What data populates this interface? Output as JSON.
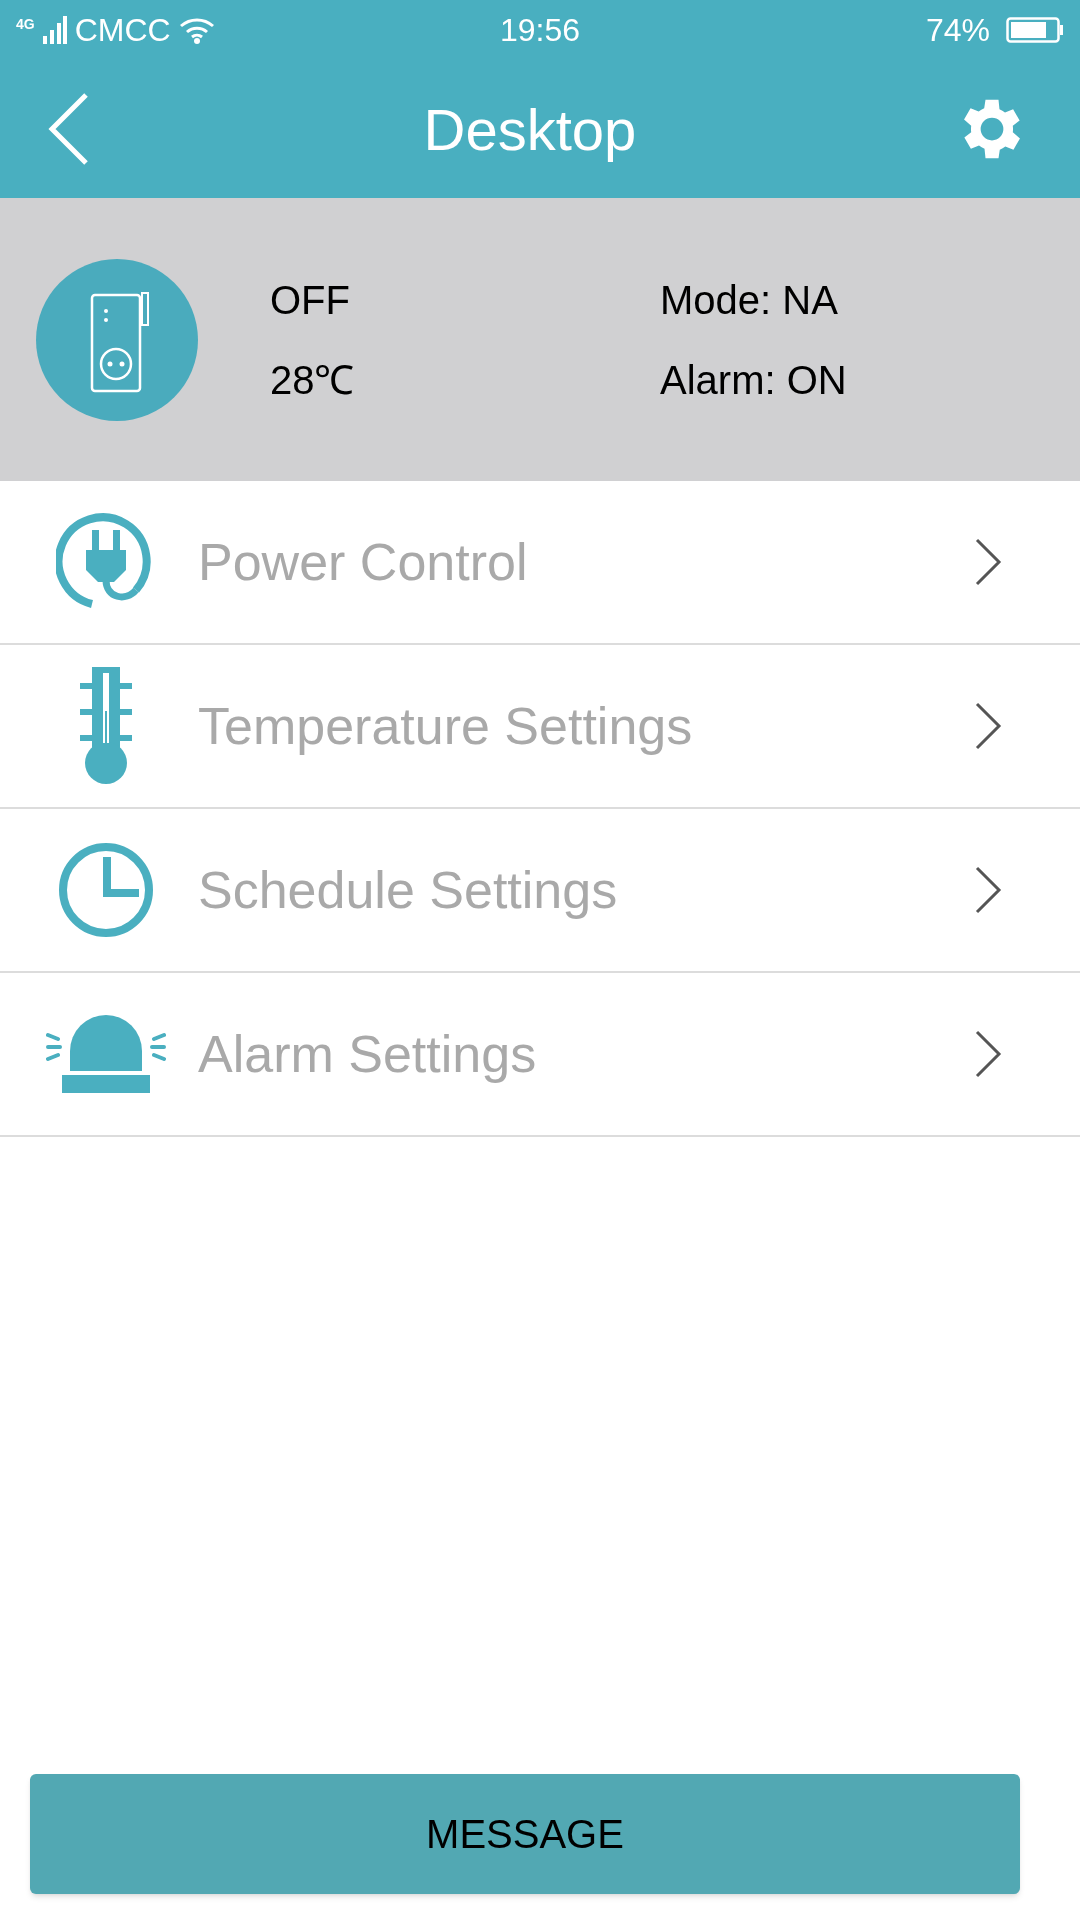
{
  "status_bar": {
    "network": "4G",
    "carrier": "CMCC",
    "time": "19:56",
    "battery": "74%"
  },
  "header": {
    "title": "Desktop"
  },
  "device": {
    "power": "OFF",
    "temperature": "28℃",
    "mode": "Mode: NA",
    "alarm": "Alarm: ON"
  },
  "menu": [
    {
      "kind": "power",
      "label": "Power Control"
    },
    {
      "kind": "temperature",
      "label": "Temperature Settings"
    },
    {
      "kind": "schedule",
      "label": "Schedule Settings"
    },
    {
      "kind": "alarm",
      "label": "Alarm Settings"
    }
  ],
  "footer": {
    "button": "MESSAGE"
  }
}
